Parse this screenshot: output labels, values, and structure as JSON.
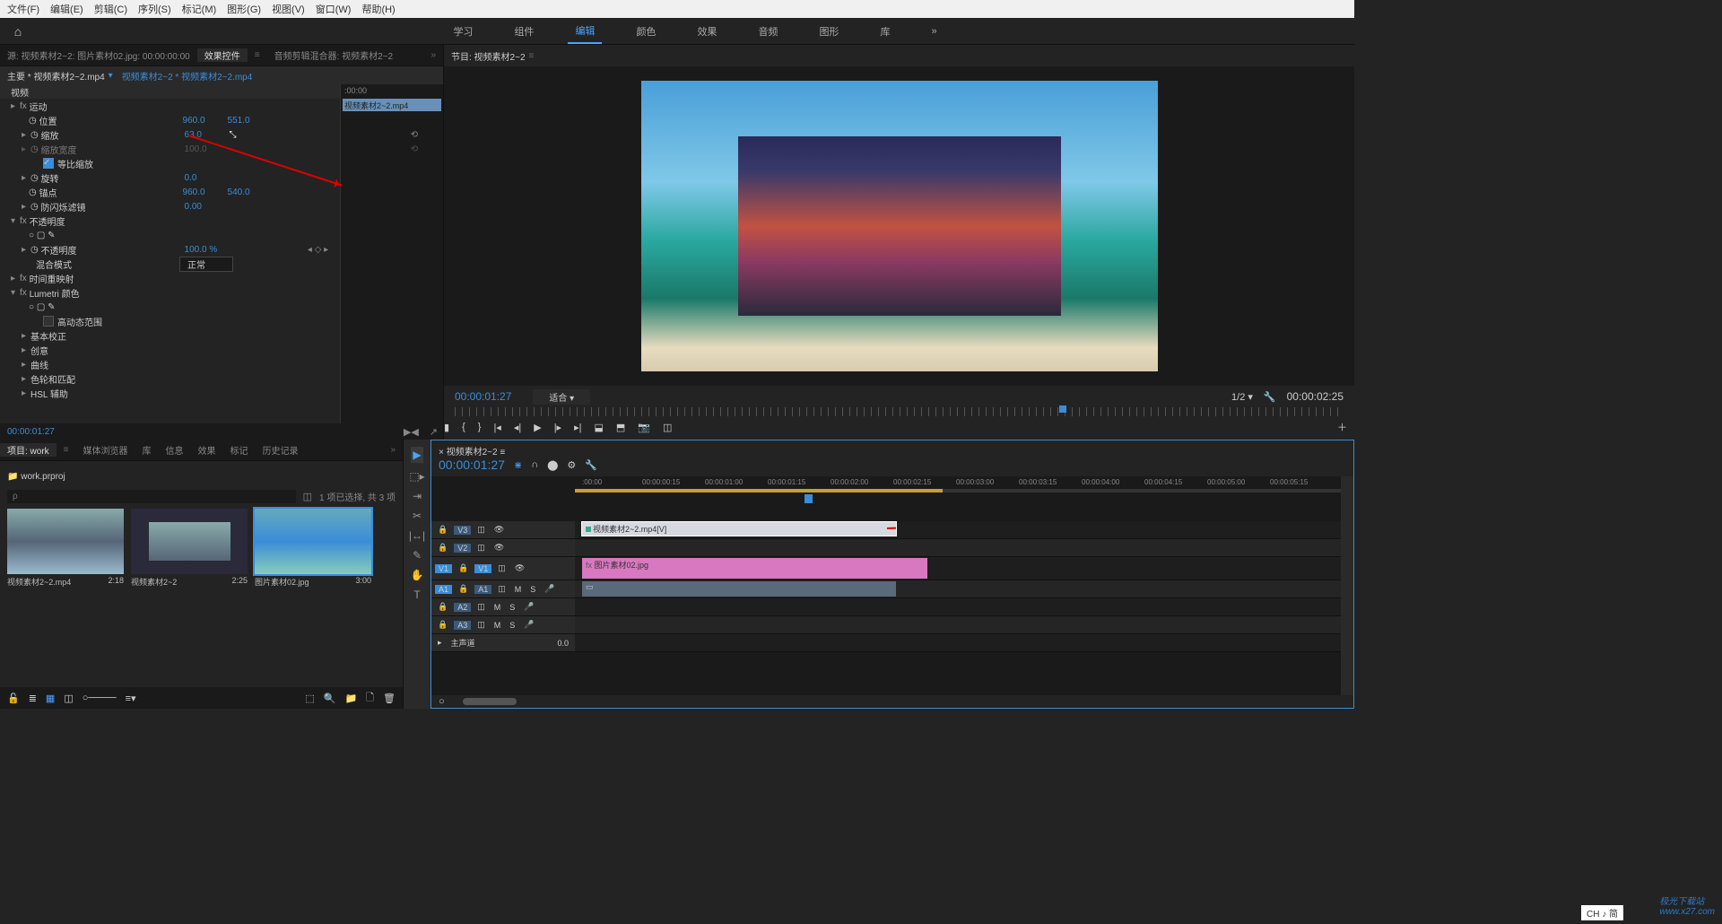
{
  "menu": {
    "items": [
      "文件(F)",
      "编辑(E)",
      "剪辑(C)",
      "序列(S)",
      "标记(M)",
      "图形(G)",
      "视图(V)",
      "窗口(W)",
      "帮助(H)"
    ]
  },
  "workspaces": {
    "items": [
      "学习",
      "组件",
      "编辑",
      "颜色",
      "效果",
      "音频",
      "图形",
      "库"
    ],
    "active": 2
  },
  "source_tabs": {
    "source": "源: 视频素材2~2: 图片素材02.jpg: 00:00:00:00",
    "effects": "效果控件",
    "audio": "音频剪辑混合器: 视频素材2~2"
  },
  "fx": {
    "breadcrumb_main": "主要 * 视频素材2~2.mp4",
    "breadcrumb_link": "视频素材2~2 * 视频素材2~2.mp4",
    "timeline_start": ":00:00",
    "clip_name": "视频素材2~2.mp4",
    "sections": {
      "video": "视频",
      "motion": "运动",
      "position": "位置",
      "position_x": "960.0",
      "position_y": "551.0",
      "scale": "缩放",
      "scale_v": "63.0",
      "scale_w": "缩放宽度",
      "scale_w_v": "100.0",
      "uniform": "等比缩放",
      "rotation": "旋转",
      "rotation_v": "0.0",
      "anchor": "锚点",
      "anchor_x": "960.0",
      "anchor_y": "540.0",
      "flicker": "防闪烁滤镜",
      "flicker_v": "0.00",
      "opacity": "不透明度",
      "opacity2": "不透明度",
      "opacity_v": "100.0 %",
      "blend": "混合模式",
      "blend_v": "正常",
      "time": "时间重映射",
      "lumetri": "Lumetri 颜色",
      "hdr": "高动态范围",
      "basic": "基本校正",
      "creative": "创意",
      "curves": "曲线",
      "wheels": "色轮和匹配",
      "hsl": "HSL 辅助"
    },
    "timecode": "00:00:01:27"
  },
  "program": {
    "title": "节目: 视频素材2~2",
    "timecode": "00:00:01:27",
    "fit": "适合",
    "zoom": "1/2",
    "duration": "00:00:02:25"
  },
  "project": {
    "tabs": [
      "项目: work",
      "媒体浏览器",
      "库",
      "信息",
      "效果",
      "标记",
      "历史记录"
    ],
    "name": "work.prproj",
    "info": "1 项已选择, 共 3 项",
    "search_ph": "ρ",
    "items": [
      {
        "name": "视频素材2~2.mp4",
        "dur": "2:18"
      },
      {
        "name": "视频素材2~2",
        "dur": "2:25"
      },
      {
        "name": "图片素材02.jpg",
        "dur": "3:00"
      }
    ]
  },
  "timeline": {
    "seqname": "视频素材2~2",
    "timecode": "00:00:01:27",
    "ruler": [
      ":00:00",
      "00:00:00:15",
      "00:00:01:00",
      "00:00:01:15",
      "00:00:02:00",
      "00:00:02:15",
      "00:00:03:00",
      "00:00:03:15",
      "00:00:04:00",
      "00:00:04:15",
      "00:00:05:00",
      "00:00:05:15"
    ],
    "tracks": {
      "v3": "V3",
      "v2": "V2",
      "v1": "V1",
      "a1": "A1",
      "a2": "A2",
      "a3": "A3",
      "patch_v1": "V1",
      "patch_a1": "A1",
      "master": "主声道",
      "master_v": "0.0"
    },
    "clips": {
      "v3": "视频素材2~2.mp4[V]",
      "v1": "图片素材02.jpg"
    },
    "track_ctrl": {
      "m": "M",
      "s": "S"
    }
  },
  "ime": "CH ♪ 简",
  "watermark": {
    "l1": "极光下载站",
    "l2": "www.x27.com"
  }
}
